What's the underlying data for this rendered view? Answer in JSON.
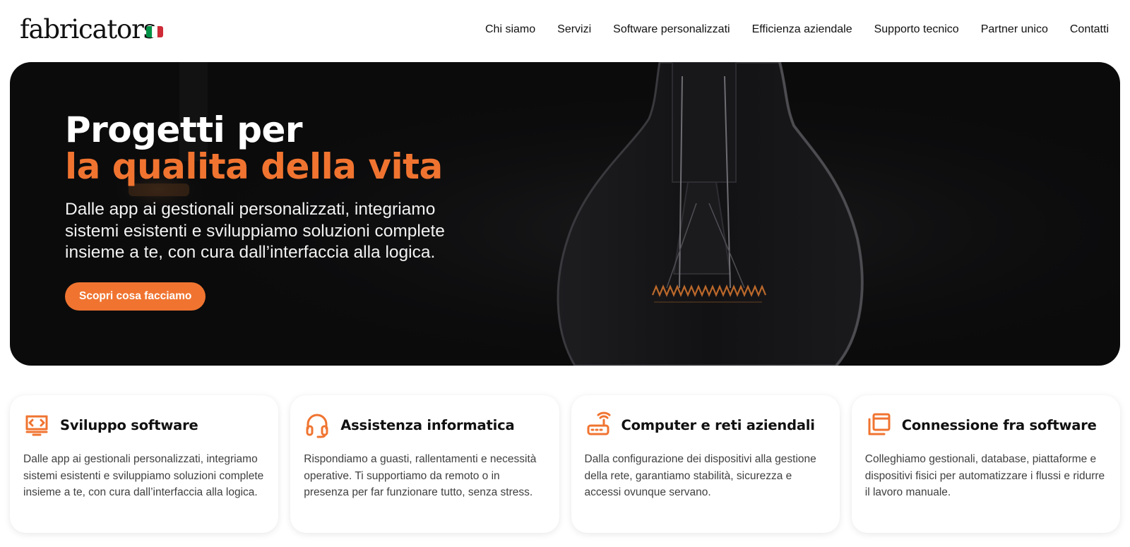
{
  "brand": {
    "logo": "fabricators",
    "flag_colors": [
      "#009246",
      "#ffffff",
      "#ce2b37"
    ]
  },
  "nav": {
    "items": [
      {
        "label": "Chi siamo"
      },
      {
        "label": "Servizi"
      },
      {
        "label": "Software personalizzati"
      },
      {
        "label": "Efficienza aziendale"
      },
      {
        "label": "Supporto tecnico"
      },
      {
        "label": "Partner unico"
      },
      {
        "label": "Contatti"
      }
    ]
  },
  "hero": {
    "title_line1": "Progetti per",
    "title_line2": "la qualita della vita",
    "text": "Dalle app ai gestionali personalizzati, integriamo sistemi esistenti e sviluppiamo soluzioni complete insieme a te, con cura dall’interfaccia alla logica.",
    "cta": "Scopri cosa facciamo"
  },
  "colors": {
    "accent": "#f07430",
    "hero_bg": "#0b0b0c"
  },
  "cards": [
    {
      "icon": "monitor-code-icon",
      "title": "Sviluppo software",
      "text": "Dalle app ai gestionali personalizzati, integriamo sistemi esistenti e sviluppiamo soluzioni complete insieme a te, con cura dall’interfaccia alla logica."
    },
    {
      "icon": "headset-icon",
      "title": "Assistenza informatica",
      "text": "Rispondiamo a guasti, rallentamenti e necessità operative. Ti supportiamo da remoto o in presenza per far funzionare tutto, senza stress."
    },
    {
      "icon": "router-icon",
      "title": "Computer e reti aziendali",
      "text": "Dalla configurazione dei dispositivi alla gestione della rete, garantiamo stabilità, sicurezza e accessi ovunque servano."
    },
    {
      "icon": "windows-stack-icon",
      "title": "Connessione fra software",
      "text": "Colleghiamo gestionali, database, piattaforme e dispositivi fisici per automatizzare i flussi e ridurre il lavoro manuale."
    }
  ]
}
